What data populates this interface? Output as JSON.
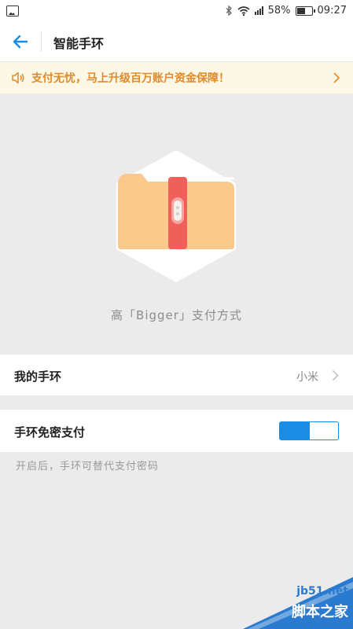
{
  "status_bar": {
    "battery": "58%",
    "time": "09:27"
  },
  "header": {
    "title": "智能手环"
  },
  "notice": {
    "text": "支付无忧，马上升级百万账户资金保障！"
  },
  "hero": {
    "caption": "高「Bigger」支付方式"
  },
  "band_row": {
    "label": "我的手环",
    "value": "小米"
  },
  "pay_row": {
    "label": "手环免密支付",
    "toggle_on": true
  },
  "hint": "开启后，手环可替代支付密码",
  "watermark": {
    "site": "jb51.net",
    "name": "脚本之家"
  },
  "colors": {
    "accent": "#1a8ce6",
    "notice_text": "#e08a2c",
    "notice_bg": "#fdf8e6",
    "band_strap": "#f0605a",
    "folder": "#fbc98b"
  }
}
